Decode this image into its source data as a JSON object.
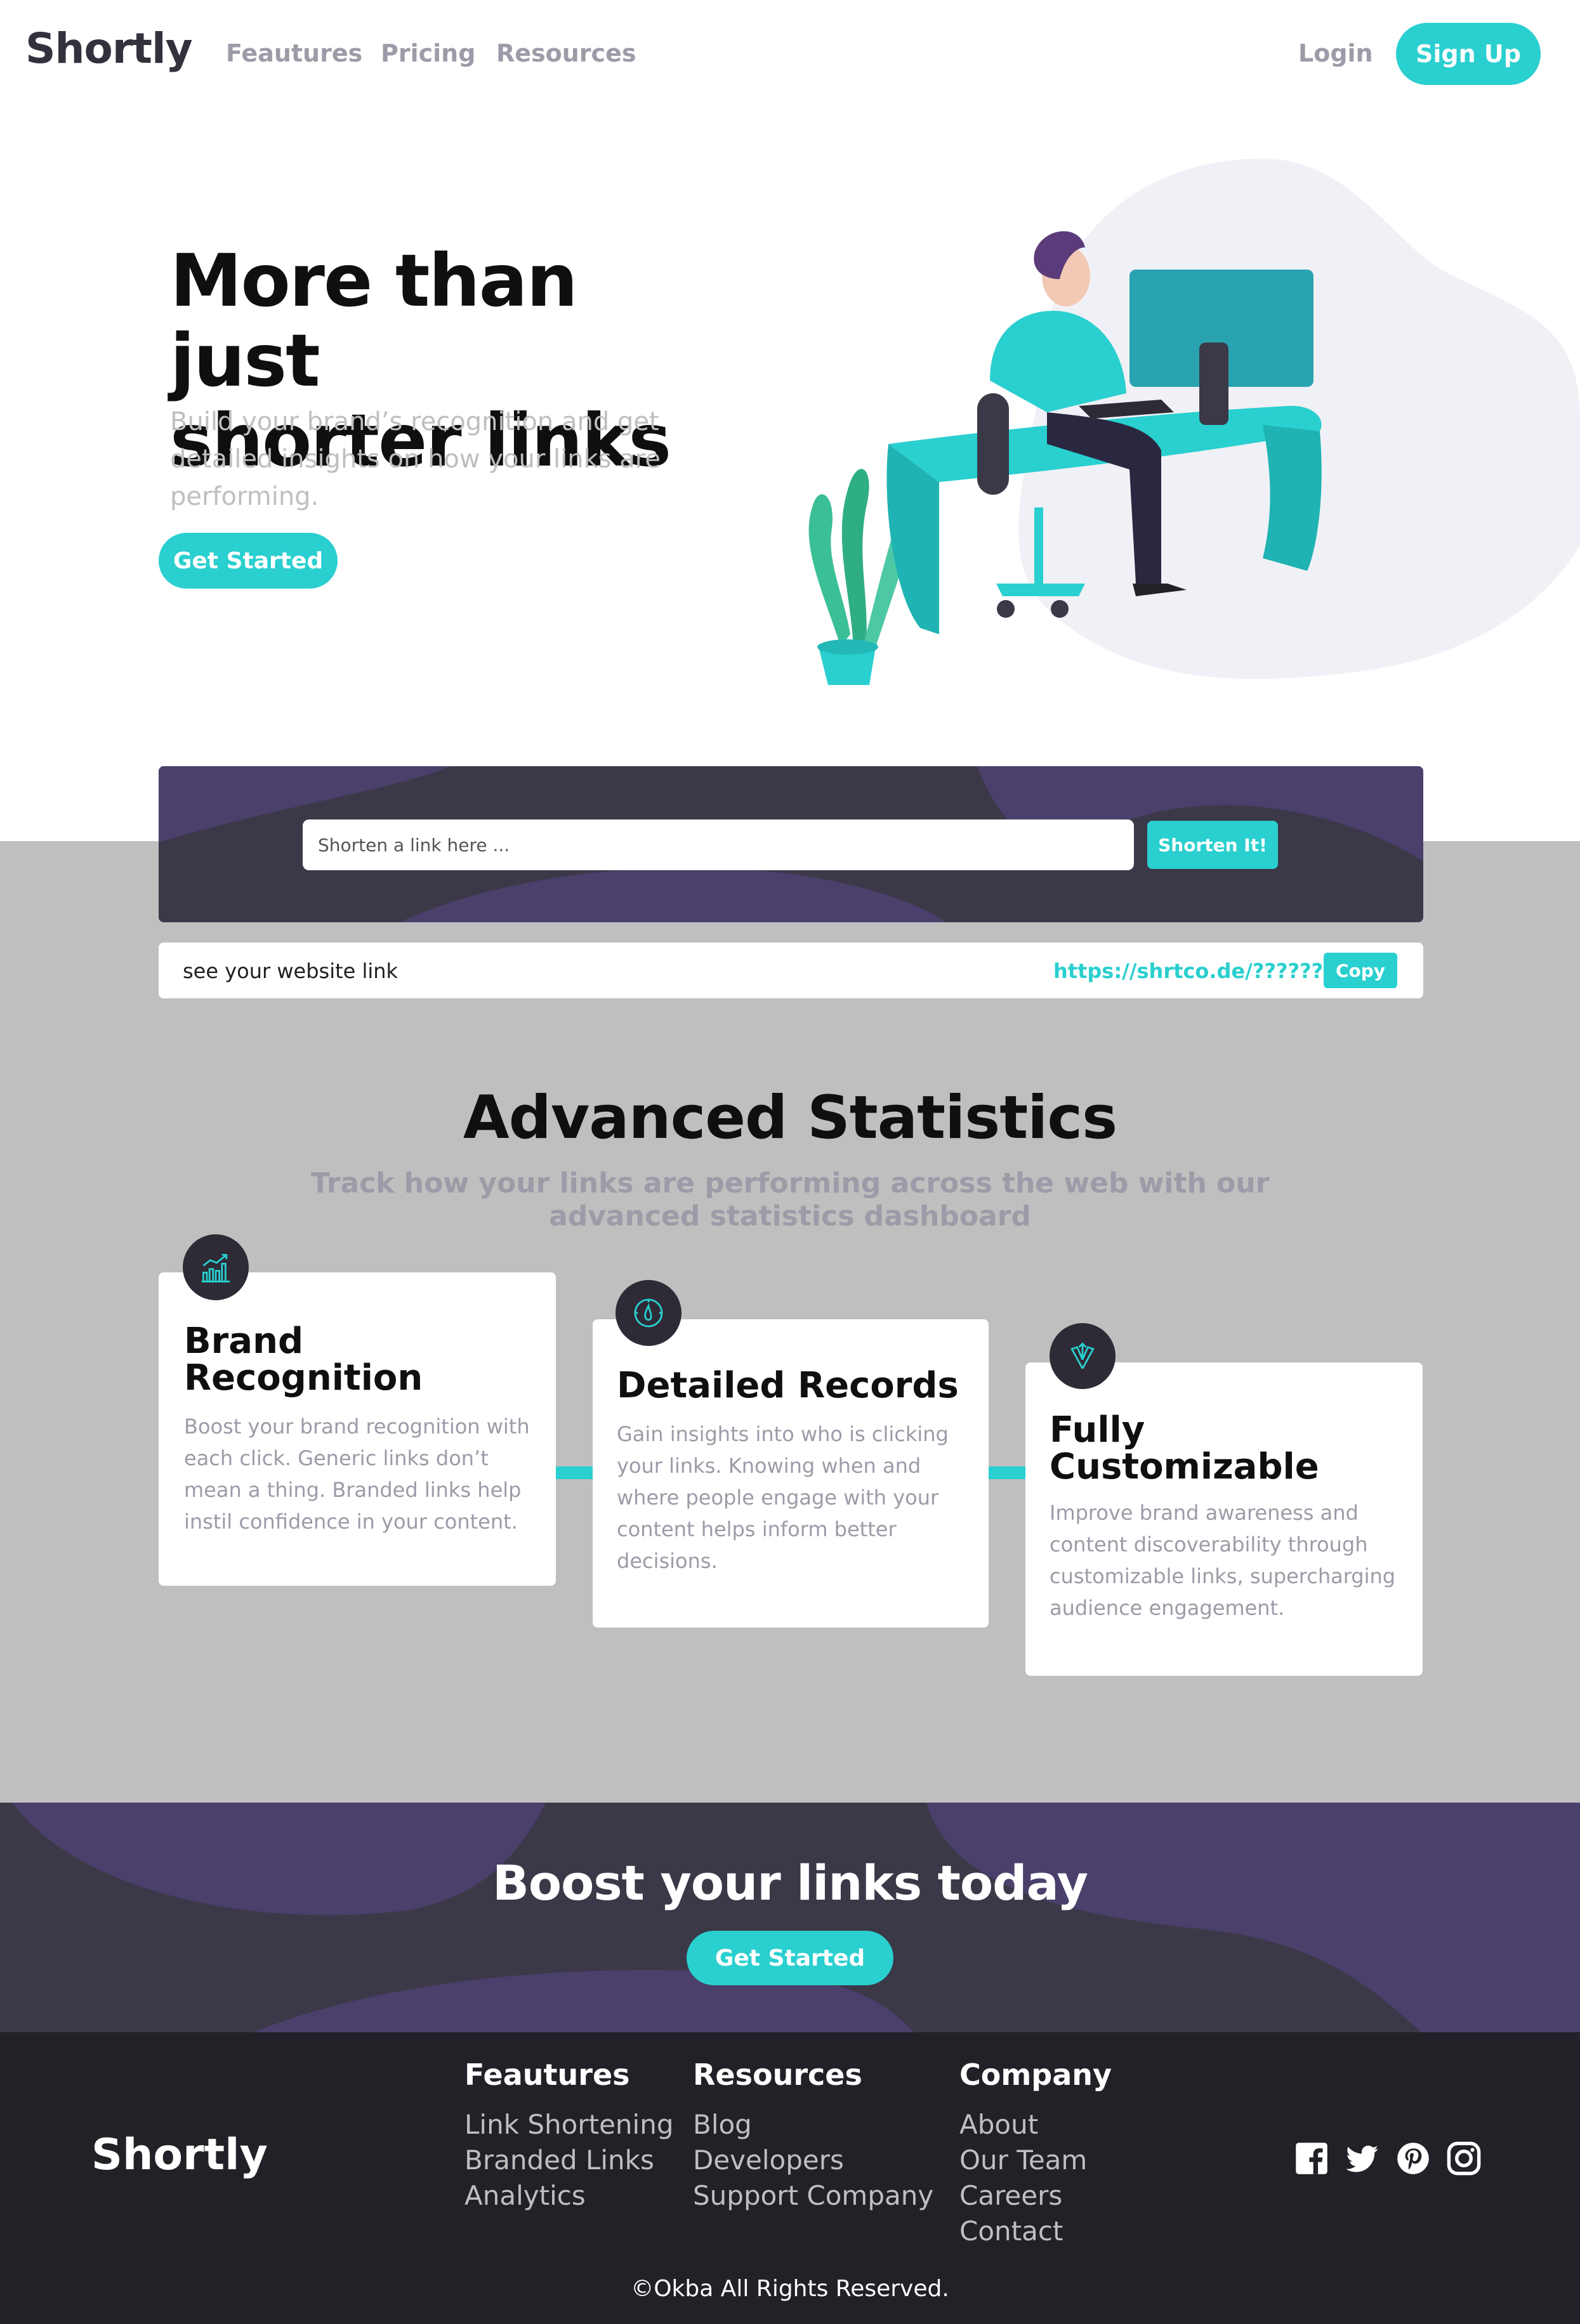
{
  "header": {
    "logo": "Shortly",
    "nav": [
      "Feautures",
      "Pricing",
      "Resources"
    ],
    "login": "Login",
    "signup": "Sign Up"
  },
  "hero": {
    "title_line1": "More than just",
    "title_line2": "shorter links",
    "subtitle": "Build your brand’s recognition and get detailed insights on how your links are performing.",
    "cta": "Get Started"
  },
  "shorten": {
    "placeholder": "Shorten a link here ...",
    "button": "Shorten It!"
  },
  "result": {
    "original": "see your website link",
    "short": "https://shrtco.de/??????",
    "copy": "Copy"
  },
  "stats": {
    "title": "Advanced Statistics",
    "subtitle": "Track how your links are performing across the web with our advanced statistics dashboard",
    "cards": [
      {
        "icon": "brand-recognition-icon",
        "title_line1": "Brand",
        "title_line2": "Recognition",
        "text": "Boost your brand recognition with each click. Generic links don’t mean a thing. Branded links help instil confidence in your content."
      },
      {
        "icon": "detailed-records-icon",
        "title_line1": "Detailed Records",
        "title_line2": "",
        "text": "Gain insights into who is clicking your links. Knowing when and where people engage with your content helps inform better decisions."
      },
      {
        "icon": "fully-customizable-icon",
        "title_line1": "Fully",
        "title_line2": "Customizable",
        "text": "Improve brand awareness and content discoverability through customizable links, supercharging audience engagement."
      }
    ]
  },
  "boost": {
    "title": "Boost your links today",
    "cta": "Get Started"
  },
  "footer": {
    "logo": "Shortly",
    "columns": [
      {
        "heading": "Feautures",
        "links": [
          "Link Shortening",
          "Branded Links",
          "Analytics"
        ]
      },
      {
        "heading": "Resources",
        "links": [
          "Blog",
          "Developers",
          "Support Company"
        ]
      },
      {
        "heading": "Company",
        "links": [
          "About",
          "Our Team",
          "Careers",
          "Contact"
        ]
      }
    ],
    "social": [
      "facebook-icon",
      "twitter-icon",
      "pinterest-icon",
      "instagram-icon"
    ],
    "copyright": "©Okba All Rights Reserved."
  },
  "colors": {
    "cyan": "#2acfcf",
    "dark_violet": "#3b3848",
    "grey_bg": "#bfbfbf",
    "footer_bg": "#232127",
    "muted_text": "#9e9aa7"
  }
}
